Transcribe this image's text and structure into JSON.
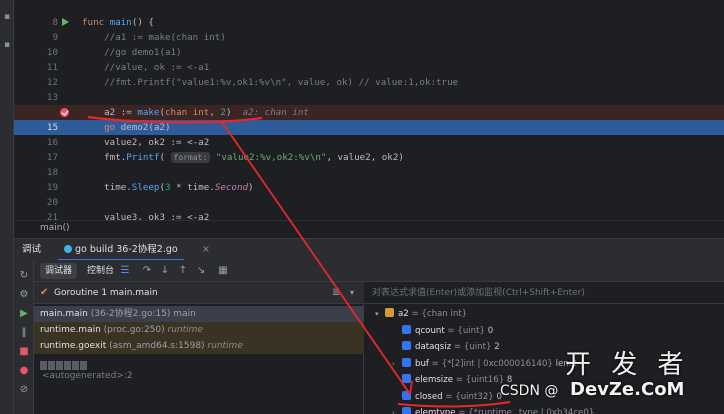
{
  "editor": {
    "lines": [
      {
        "n": "8",
        "html": "<span class=\"kw\">func</span> <span class=\"fn\">main</span>() {"
      },
      {
        "n": "9",
        "html": "    <span class=\"cm\">//a1 := make(chan int)</span>"
      },
      {
        "n": "10",
        "html": "    <span class=\"cm\">//go demo1(a1)</span>"
      },
      {
        "n": "11",
        "html": "    <span class=\"cm\">//value, ok := &lt;-a1</span>"
      },
      {
        "n": "12",
        "html": "    <span class=\"cm\">//fmt.Printf(\"value1:%v,ok1:%v\\n\", value, ok) // value:1,ok:true</span>"
      },
      {
        "n": "13",
        "html": ""
      },
      {
        "n": "",
        "html": "    a2 := <span class=\"fn\">make</span>(<span class=\"kw\">chan</span> <span class=\"tp\">int</span>, <span class=\"num\">2</span>)  <span class=\"inlay\">a2: chan int</span>"
      },
      {
        "n": "15",
        "html": "    <span class=\"kw\">go</span> demo2(a2)"
      },
      {
        "n": "16",
        "html": "    value2, ok2 := &lt;-a2"
      },
      {
        "n": "17",
        "html": "    fmt.<span class=\"fn\">Printf</span>( <span class=\"hint\">format:</span> <span class=\"str\">\"value2:%v,ok2:%v\\n\"</span>, value2, ok2)"
      },
      {
        "n": "18",
        "html": ""
      },
      {
        "n": "19",
        "html": "    time.<span class=\"fn\">Sleep</span>(<span class=\"num\">3</span> * time.<span class=\"fld\">Second</span>)"
      },
      {
        "n": "20",
        "html": ""
      },
      {
        "n": "21",
        "html": "    value3, ok3 := &lt;-a2"
      }
    ],
    "breadcrumb": "main()"
  },
  "debug": {
    "title": "调试",
    "session_tab": "go build 36-2协程2.go",
    "session_close": "×",
    "tabs": [
      "调试器",
      "控制台"
    ],
    "goroutine": "Goroutine 1 main.main",
    "goroutine_check": "✔",
    "filter_icon": "≣",
    "dropdown_icon": "▾",
    "frames": [
      {
        "name": "main.main",
        "loc": " (36-2协程2.go:15) main",
        "pkg": ""
      },
      {
        "name": "runtime.main",
        "loc": " (proc.go:250) ",
        "pkg": "runtime"
      },
      {
        "name": "runtime.goexit",
        "loc": " (asm_amd64.s:1598) ",
        "pkg": "runtime"
      }
    ],
    "autogenerated": "<autogenerated>:2",
    "eval_placeholder": "对表达式求值(Enter)或添加监视(Ctrl+Shift+Enter)",
    "variables": [
      {
        "indent": 0,
        "caret": "▾",
        "root": true,
        "name": "a2",
        "type": " = {chan int}",
        "val": ""
      },
      {
        "indent": 1,
        "caret": "",
        "root": false,
        "name": "qcount",
        "type": " = {uint} ",
        "val": "0"
      },
      {
        "indent": 1,
        "caret": "",
        "root": false,
        "name": "dataqsiz",
        "type": " = {uint} ",
        "val": "2"
      },
      {
        "indent": 1,
        "caret": "›",
        "root": false,
        "name": "buf",
        "type": " = {*[2]int | 0xc000016140} ",
        "val": "len:2"
      },
      {
        "indent": 1,
        "caret": "",
        "root": false,
        "name": "elemsize",
        "type": " = {uint16} ",
        "val": "8"
      },
      {
        "indent": 1,
        "caret": "",
        "root": false,
        "name": "closed",
        "type": " = {uint32} ",
        "val": "0"
      },
      {
        "indent": 1,
        "caret": "›",
        "root": false,
        "name": "elemtype",
        "type": " = {*runtime._type | 0xb34ce0}",
        "val": ""
      }
    ]
  },
  "watermark": {
    "cn": "开 发 者",
    "csdn": "CSDN @",
    "site": "DevZe.CoM"
  },
  "colors": {
    "accent": "#3574f0",
    "breakpoint": "#e55765",
    "annotation": "#e8262d"
  }
}
